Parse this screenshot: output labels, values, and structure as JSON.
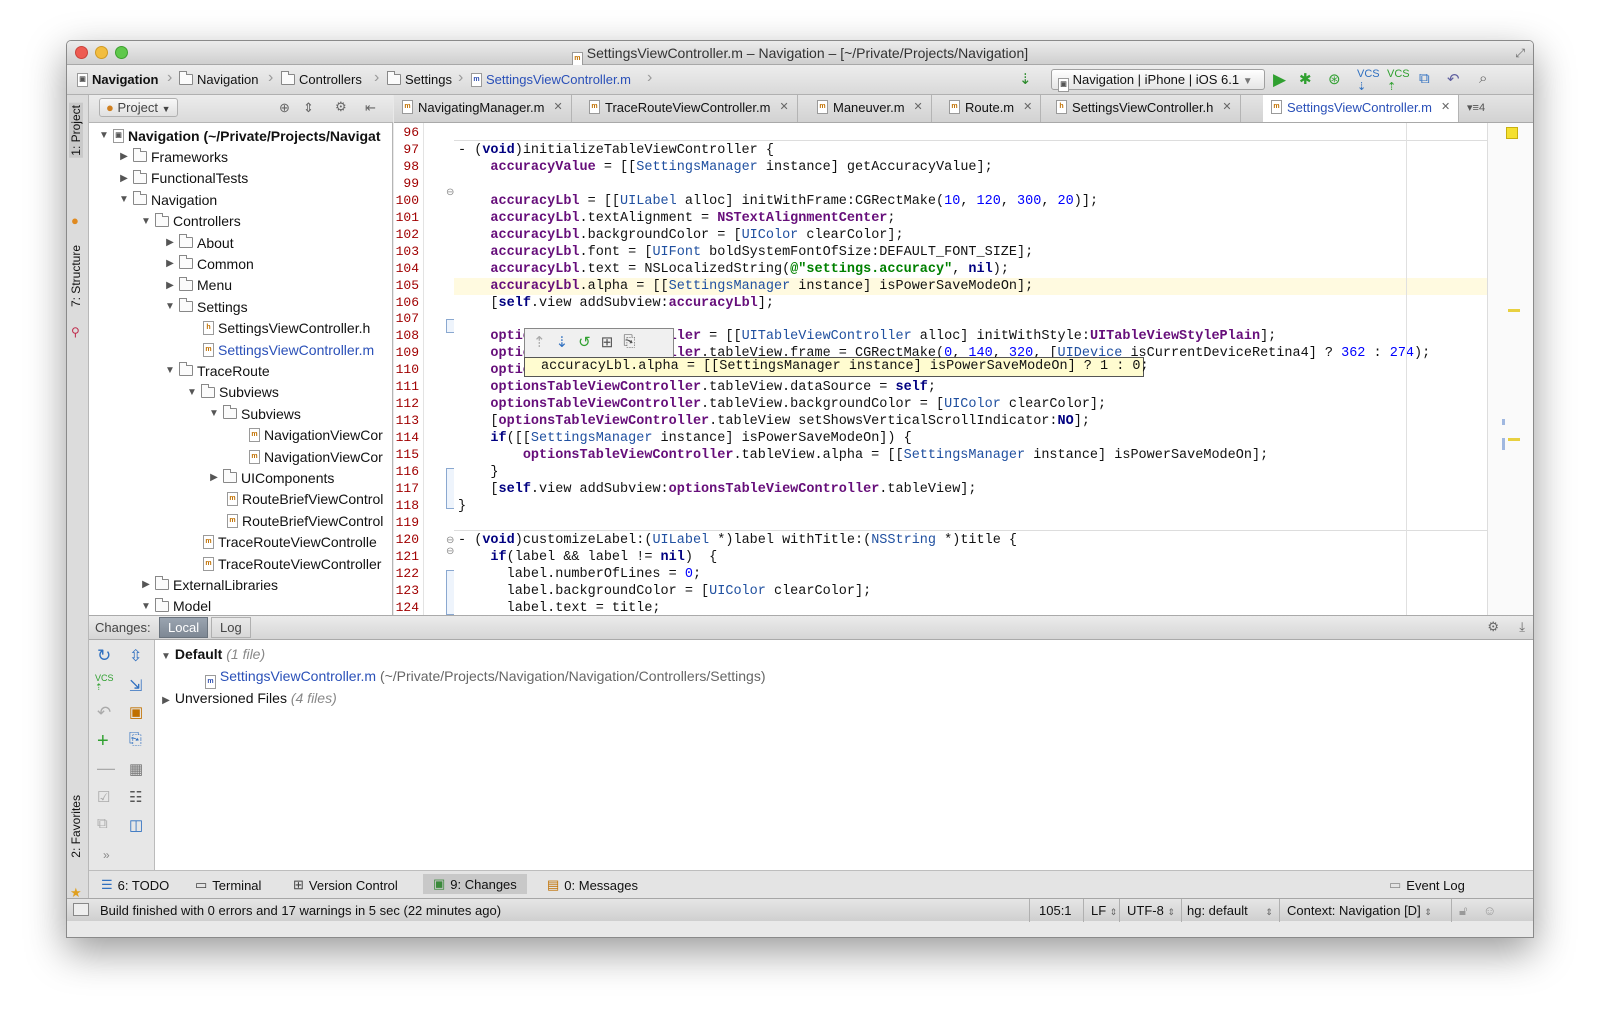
{
  "window": {
    "title": "SettingsViewController.m – Navigation – [~/Private/Projects/Navigation]"
  },
  "breadcrumbs": [
    "Navigation",
    "Navigation",
    "Controllers",
    "Settings",
    "SettingsViewController.m"
  ],
  "run_config": "Navigation | iPhone | iOS 6.1",
  "left_tabs": {
    "project": "1: Project",
    "structure": "7: Structure",
    "favorites": "2: Favorites"
  },
  "project_panel": {
    "title": "Project"
  },
  "tree": [
    {
      "label": "Navigation (~/Private/Projects/Navigat",
      "bold": true
    },
    {
      "label": "Frameworks"
    },
    {
      "label": "FunctionalTests"
    },
    {
      "label": "Navigation"
    },
    {
      "label": "Controllers"
    },
    {
      "label": "About"
    },
    {
      "label": "Common"
    },
    {
      "label": "Menu"
    },
    {
      "label": "Settings"
    },
    {
      "label": "SettingsViewController.h"
    },
    {
      "label": "SettingsViewController.m"
    },
    {
      "label": "TraceRoute"
    },
    {
      "label": "Subviews"
    },
    {
      "label": "Subviews"
    },
    {
      "label": "NavigationViewCor"
    },
    {
      "label": "NavigationViewCor"
    },
    {
      "label": "UIComponents"
    },
    {
      "label": "RouteBriefViewControl"
    },
    {
      "label": "RouteBriefViewControl"
    },
    {
      "label": "TraceRouteViewControlle"
    },
    {
      "label": "TraceRouteViewController"
    },
    {
      "label": "ExternalLibraries"
    },
    {
      "label": "Model"
    }
  ],
  "editor_tabs": [
    "NavigatingManager.m",
    "TraceRouteViewController.m",
    "Maneuver.m",
    "Route.m",
    "SettingsViewController.h",
    "SettingsViewController.m"
  ],
  "editor_tabs_overflow": "4",
  "line_numbers": [
    "96",
    "97",
    "98",
    "99",
    "100",
    "101",
    "102",
    "103",
    "104",
    "105",
    "106",
    "107",
    "108",
    "109",
    "110",
    "111",
    "112",
    "113",
    "114",
    "115",
    "116",
    "117",
    "118",
    "119",
    "120",
    "121",
    "122",
    "123",
    "124"
  ],
  "code": [
    "",
    "- (void)initializeTableViewController {",
    "    accuracyValue = [[SettingsManager instance] getAccuracyValue];",
    "",
    "    accuracyLbl = [[UILabel alloc] initWithFrame:CGRectMake(10, 120, 300, 20)];",
    "    accuracyLbl.textAlignment = NSTextAlignmentCenter;",
    "    accuracyLbl.backgroundColor = [UIColor clearColor];",
    "    accuracyLbl.font = [UIFont boldSystemFontOfSize:DEFAULT_FONT_SIZE];",
    "    accuracyLbl.text = NSLocalizedString(@\"settings.accuracy\", nil);",
    "    accuracyLbl.alpha = [[SettingsManager instance] isPowerSaveModeOn];",
    "    [self.view addSubview:accuracyLbl];",
    "",
    "    optionsTableViewController = [[UITableViewController alloc] initWithStyle:UITableViewStylePlain];",
    "    optionsTableViewController.tableView.frame = CGRectMake(0, 140, 320, [UIDevice isCurrentDeviceRetina4] ? 362 : 274);",
    "    optionsTableViewController.tableView.delegate = self;",
    "    optionsTableViewController.tableView.dataSource = self;",
    "    optionsTableViewController.tableView.backgroundColor = [UIColor clearColor];",
    "    [optionsTableViewController.tableView setShowsVerticalScrollIndicator:NO];",
    "    if([[SettingsManager instance] isPowerSaveModeOn]) {",
    "        optionsTableViewController.tableView.alpha = [[SettingsManager instance] isPowerSaveModeOn];",
    "    }",
    "    [self.view addSubview:optionsTableViewController.tableView];",
    "}",
    "",
    "- (void)customizeLabel:(UILabel *)label withTitle:(NSString *)title {",
    "    if(label && label != nil)  {",
    "      label.numberOfLines = 0;",
    "      label.backgroundColor = [UIColor clearColor];",
    "      label.text = title;"
  ],
  "tooltip": "accuracyLbl.alpha = [[SettingsManager instance] isPowerSaveModeOn] ? 1 : 0;",
  "changes": {
    "title": "Changes:",
    "tabs": [
      "Local",
      "Log"
    ],
    "default_label": "Default",
    "default_count": "(1 file)",
    "file": "SettingsViewController.m",
    "file_path": "(~/Private/Projects/Navigation/Navigation/Controllers/Settings)",
    "unversioned_label": "Unversioned Files",
    "unversioned_count": "(4 files)"
  },
  "tool_windows": [
    "6: TODO",
    "Terminal",
    "Version Control",
    "9: Changes",
    "0: Messages"
  ],
  "event_log": "Event Log",
  "status": {
    "message": "Build finished with 0 errors and 17 warnings in 5 sec (22 minutes ago)",
    "position": "105:1",
    "line_sep": "LF",
    "encoding": "UTF-8",
    "vcs": "hg: default",
    "context": "Context: Navigation [D]"
  },
  "colors": {
    "accent": "#3060c0",
    "line_number": "#a00000",
    "keyword": "#000080",
    "string": "#008000"
  }
}
